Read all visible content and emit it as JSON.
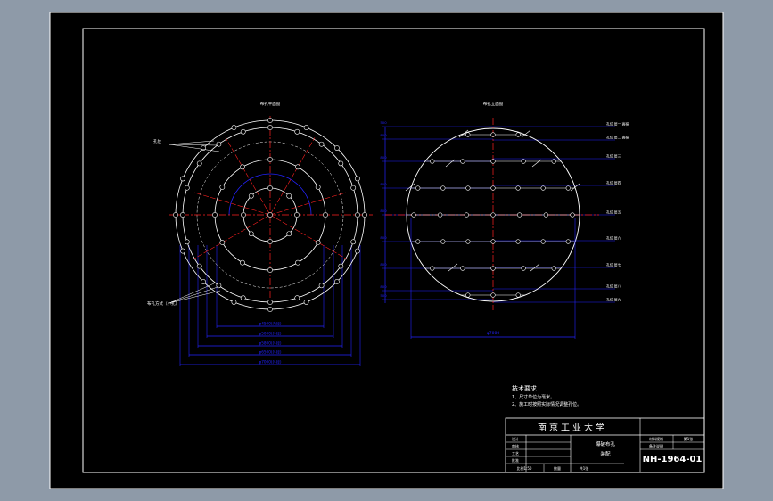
{
  "colors": {
    "background": "#8e9aa8",
    "paper": "#000000",
    "line": "#ffffff",
    "dimension": "#2323ff",
    "centerline": "#ff2020"
  },
  "views": {
    "left_title": "布孔平面图",
    "right_title": "布孔立面图",
    "left_callout_top": "孔位",
    "left_callout_bottom": "布孔方式（小孔）",
    "left_dims": [
      "φ4500(内径)",
      "φ5000(外径)",
      "φ5800(外径)",
      "φ6500(外径)",
      "φ7000(外径)"
    ],
    "right_width_dim": "φ7000",
    "right_level_labels": [
      "孔位 层一 高程",
      "孔位 层二 高程",
      "孔位 层三",
      "孔位 层四",
      "孔位 层五",
      "孔位 层六",
      "孔位 层七",
      "孔位 层八",
      "孔位 层九"
    ],
    "right_vertical_dims": [
      "500",
      "800",
      "800",
      "800",
      "800",
      "800",
      "800",
      "800",
      "500"
    ]
  },
  "notes": {
    "heading": "技术要求",
    "items": [
      "1、尺寸单位为毫米。",
      "2、施工时按照实际情况调整孔位。"
    ]
  },
  "titleblock": {
    "school": "南京工业大学",
    "drawing_name": "爆破布孔",
    "drawing_sub": "装配",
    "drawing_number": "NH-1964-01",
    "row_labels": [
      "设计",
      "审核",
      "工艺",
      "批准"
    ],
    "bottom_cells": [
      "比例1:50",
      "数量",
      "共1张"
    ],
    "right_labels": [
      "材料规格",
      "备注说明",
      "第1张"
    ]
  }
}
